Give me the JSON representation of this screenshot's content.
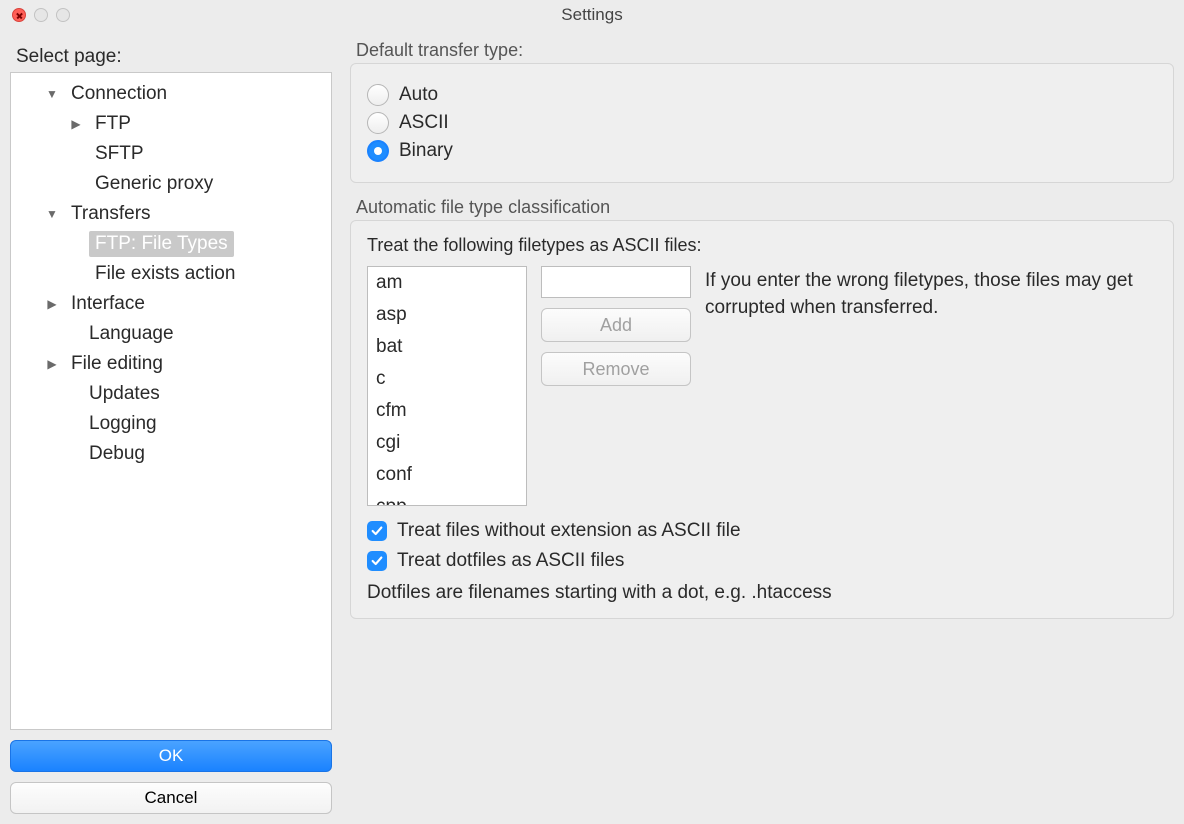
{
  "titlebar": {
    "title": "Settings"
  },
  "sidebar": {
    "label": "Select page:",
    "tree": {
      "connection": "Connection",
      "ftp": "FTP",
      "sftp": "SFTP",
      "generic_proxy": "Generic proxy",
      "transfers": "Transfers",
      "ftp_file_types": "FTP: File Types",
      "file_exists_action": "File exists action",
      "interface": "Interface",
      "language": "Language",
      "file_editing": "File editing",
      "updates": "Updates",
      "logging": "Logging",
      "debug": "Debug"
    },
    "ok": "OK",
    "cancel": "Cancel"
  },
  "transfer_type": {
    "group_label": "Default transfer type:",
    "auto": "Auto",
    "ascii": "ASCII",
    "binary": "Binary",
    "selected": "binary"
  },
  "auto_class": {
    "group_label": "Automatic file type classification",
    "heading": "Treat the following filetypes as ASCII files:",
    "filetypes": [
      "am",
      "asp",
      "bat",
      "c",
      "cfm",
      "cgi",
      "conf",
      "cpp"
    ],
    "input_value": "",
    "add": "Add",
    "remove": "Remove",
    "hint": "If you enter the wrong filetypes, those files may get corrupted when transferred.",
    "check_noext": "Treat files without extension as ASCII file",
    "check_dotfiles": "Treat dotfiles as ASCII files",
    "note": "Dotfiles are filenames starting with a dot, e.g. .htaccess"
  }
}
